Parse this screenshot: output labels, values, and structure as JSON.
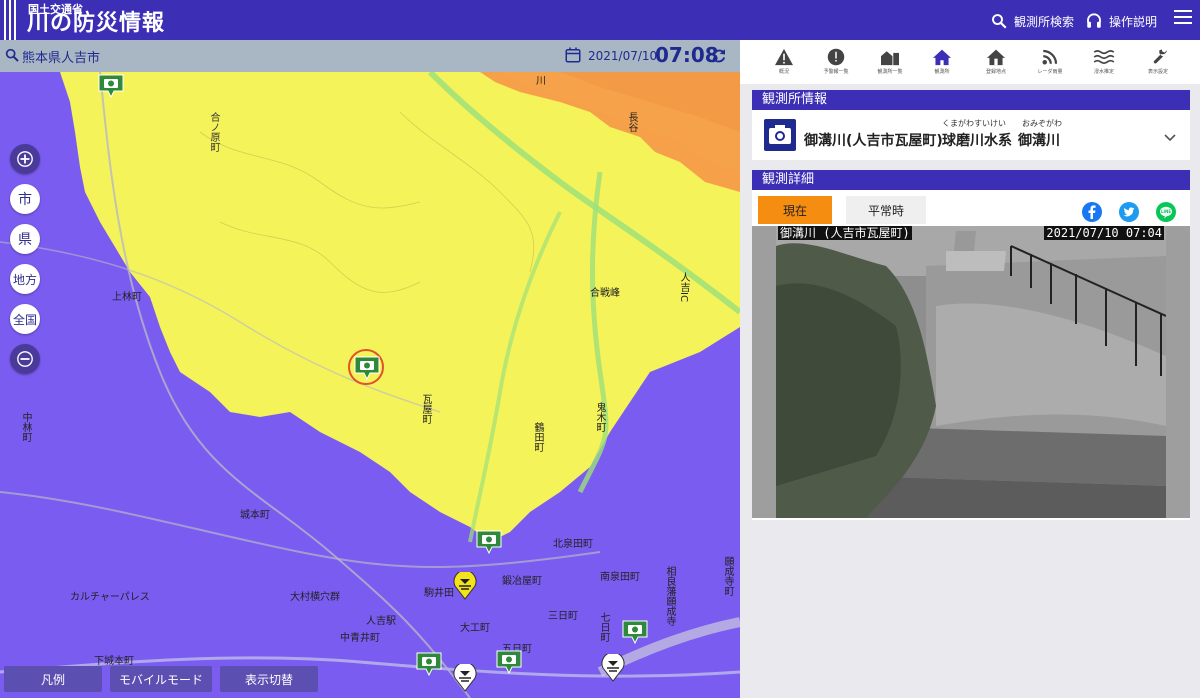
{
  "header": {
    "org_label": "国土交通省",
    "site_title": "川の防災情報",
    "search_stations_label": "観測所検索",
    "help_label": "操作説明"
  },
  "searchbar": {
    "location": "熊本県人吉市",
    "date": "2021/07/10",
    "time": "07:08"
  },
  "map": {
    "zoom_in_icon": "plus-icon",
    "zoom_out_icon": "minus-icon",
    "scale_buttons": [
      "市",
      "県",
      "地方",
      "全国"
    ],
    "bottom_buttons": [
      "凡例",
      "モバイルモード",
      "表示切替"
    ],
    "labels": [
      {
        "text": "合ノ原町"
      },
      {
        "text": "上林町"
      },
      {
        "text": "中林町"
      },
      {
        "text": "城本町"
      },
      {
        "text": "北泉田町"
      },
      {
        "text": "南泉田町"
      },
      {
        "text": "駒井田"
      },
      {
        "text": "鍛冶屋町"
      },
      {
        "text": "大村横穴群"
      },
      {
        "text": "人吉駅"
      },
      {
        "text": "中青井町"
      },
      {
        "text": "大工町"
      },
      {
        "text": "三日町"
      },
      {
        "text": "五日町"
      },
      {
        "text": "下城本町"
      },
      {
        "text": "カルチャーパレス"
      },
      {
        "text": "瓦屋町"
      },
      {
        "text": "鶴田町"
      },
      {
        "text": "鬼木町"
      },
      {
        "text": "合戦峰"
      },
      {
        "text": "人吉IC"
      },
      {
        "text": "相良藩願成寺"
      },
      {
        "text": "願成寺町"
      },
      {
        "text": "七日町"
      },
      {
        "text": "川"
      },
      {
        "text": "長谷"
      }
    ]
  },
  "toolbar": {
    "items": [
      "概況",
      "予警報一覧",
      "観測所一覧",
      "観測所",
      "登録地点",
      "レーダ雨量",
      "浸水推定",
      "表示設定"
    ]
  },
  "station_info": {
    "heading": "観測所情報",
    "name": "御溝川(人吉市瓦屋町)",
    "system": "球磨川水系",
    "system_ruby": "くまがわすいけい",
    "river": "御溝川",
    "river_ruby": "おみぞがわ",
    "expand_icon": "chevron-down-icon"
  },
  "detail": {
    "heading": "観測詳細",
    "tab_now": "現在",
    "tab_normal": "平常時",
    "share_icons": [
      "facebook-icon",
      "twitter-icon",
      "line-icon"
    ],
    "camera_caption": "御溝川 (人吉市瓦屋町)",
    "camera_timestamp": "2021/07/10 07:04"
  },
  "colors": {
    "header": "#3c2eb5",
    "flood_yellow": "#f4f35a",
    "flood_purple": "#7a5cf0",
    "flood_orange": "#f6a04a",
    "tab_active": "#f58d10"
  }
}
